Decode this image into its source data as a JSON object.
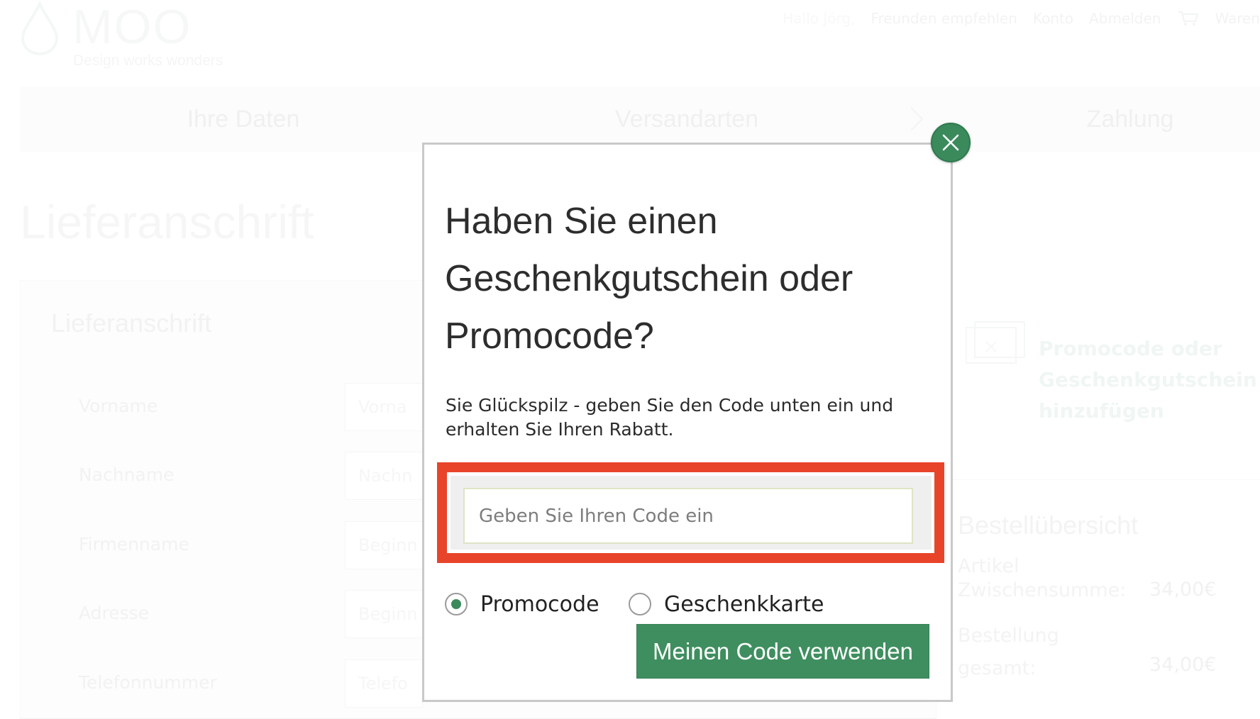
{
  "header": {
    "logo_text": "MOO",
    "tagline": "Design works wonders",
    "nav": {
      "greeting": "Hallo Jörg,",
      "refer": "Freunden empfehlen",
      "account": "Konto",
      "logout": "Abmelden",
      "cart": "Waren"
    }
  },
  "steps": [
    "Ihre Daten",
    "Versandarten",
    "Zahlung"
  ],
  "page": {
    "title": "Lieferanschrift",
    "section_title": "Lieferanschrift",
    "fields": [
      {
        "label": "Vorname",
        "placeholder": "Vorna"
      },
      {
        "label": "Nachname",
        "placeholder": "Nachn"
      },
      {
        "label": "Firmenname",
        "placeholder": "Beginn"
      },
      {
        "label": "Adresse",
        "placeholder": "Beginn"
      },
      {
        "label": "Telefonnummer",
        "placeholder": "Telefo"
      }
    ]
  },
  "sidebar": {
    "promo_link": "Promocode oder Geschenkgutschein hinzufügen",
    "summary_title": "Bestellübersicht",
    "subtotal_label": "Artikel Zwischensumme:",
    "subtotal_value": "34,00€",
    "total_label": "Bestellung gesamt:",
    "total_value": "34,00€"
  },
  "modal": {
    "title": "Haben Sie einen Geschenkgutschein oder Promocode?",
    "description": "Sie Glückspilz - geben Sie den Code unten ein und erhalten Sie Ihren Rabatt.",
    "input_placeholder": "Geben Sie Ihren Code ein",
    "input_value": "",
    "options": [
      {
        "label": "Promocode",
        "selected": true
      },
      {
        "label": "Geschenkkarte",
        "selected": false
      }
    ],
    "submit_label": "Meinen Code verwenden"
  },
  "colors": {
    "brand_green": "#3f8e5f",
    "highlight_red": "#e8442a"
  }
}
